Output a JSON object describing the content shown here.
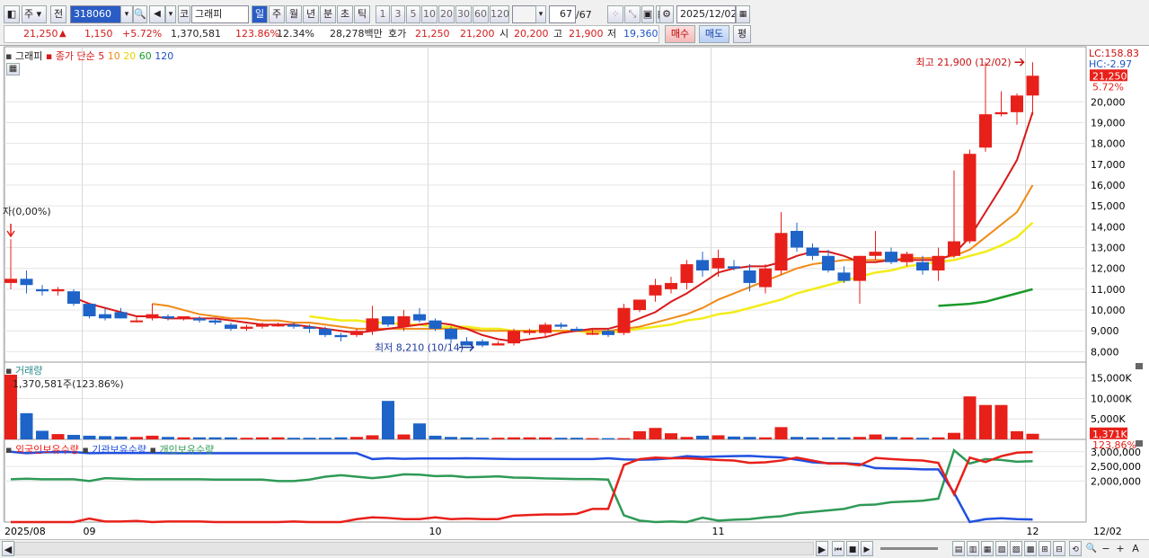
{
  "toolbar": {
    "jong": "주",
    "jeon": "전",
    "code": "318060",
    "name_prefix": "코",
    "stock_name": "그래피",
    "periods": [
      "일",
      "주",
      "월",
      "년",
      "분",
      "초",
      "틱"
    ],
    "active_period": "일",
    "intervals": [
      "1",
      "3",
      "5",
      "10",
      "20",
      "30",
      "60",
      "120"
    ],
    "count": "67",
    "count_total": "/67",
    "date": "2025/12/02"
  },
  "info": {
    "price": "21,250",
    "arrow": "▲",
    "change": "1,150",
    "rate": "+5.72%",
    "volume": "1,370,581",
    "vol_ratio": "123.86%",
    "turnover": "12.34%",
    "amount": "28,278백만",
    "hoga_label": "호가",
    "ask": "21,250",
    "bid": "21,200",
    "open_label": "시",
    "open": "20,200",
    "high_label": "고",
    "high": "21,900",
    "low_label": "저",
    "low": "19,360",
    "buy_btn": "매수",
    "sell_btn": "매도",
    "eval_btn": "평"
  },
  "legend": {
    "name": "그래피",
    "close_label": "종가 단순",
    "ma5": "5",
    "ma10": "10",
    "ma20": "20",
    "ma60": "60",
    "ma120": "120",
    "volume_title": "거래량",
    "volume_value": "1,370,581주(123.86%)",
    "holdings": [
      "외국인보유수량",
      "기관보유수량",
      "개인보유수량"
    ]
  },
  "colors": {
    "up": "#e8201a",
    "down": "#1e63c8",
    "ma5": "#d81a1a",
    "ma10": "#f08a16",
    "ma20": "#f2ec1a",
    "ma60": "#1a9a2a",
    "foreign": "#e8201a",
    "inst": "#2050e0",
    "indiv": "#2e9a56"
  },
  "annotations": {
    "lc": "LC:158.83",
    "hc": "HC:-2.97",
    "cur_price": "21,250",
    "cur_rate": "5.72%",
    "max": "최고 21,900 (12/02)",
    "min": "최저 8,210 (10/14)",
    "first": "자(0,00%)",
    "vol_cur": "1,371K",
    "vol_rate": "123.86%"
  },
  "chart_data": {
    "type": "candlestick",
    "ylim": [
      7500,
      22600
    ],
    "yticks": [
      "8,000",
      "9,000",
      "10,000",
      "11,000",
      "12,000",
      "13,000",
      "14,000",
      "15,000",
      "16,000",
      "17,000",
      "18,000",
      "19,000",
      "20,000"
    ],
    "ytick_values": [
      8000,
      9000,
      10000,
      11000,
      12000,
      13000,
      14000,
      15000,
      16000,
      17000,
      18000,
      19000,
      20000
    ],
    "xlabels": [
      {
        "label": "2025/08",
        "i": 0
      },
      {
        "label": "09",
        "i": 5
      },
      {
        "label": "10",
        "i": 27
      },
      {
        "label": "11",
        "i": 45
      },
      {
        "label": "12",
        "i": 65
      }
    ],
    "xlabel_right": "12/02",
    "candles": [
      [
        11300,
        13400,
        11000,
        11500
      ],
      [
        11500,
        11900,
        10800,
        11200
      ],
      [
        11000,
        11200,
        10700,
        10900
      ],
      [
        10900,
        11100,
        10700,
        11000
      ],
      [
        10900,
        11000,
        10200,
        10300
      ],
      [
        10300,
        10300,
        9600,
        9700
      ],
      [
        9800,
        10100,
        9500,
        9600
      ],
      [
        9900,
        10100,
        9600,
        9600
      ],
      [
        9500,
        9700,
        9400,
        9500
      ],
      [
        9600,
        10300,
        9500,
        9800
      ],
      [
        9700,
        9800,
        9500,
        9600
      ],
      [
        9600,
        9700,
        9500,
        9700
      ],
      [
        9600,
        9700,
        9400,
        9500
      ],
      [
        9500,
        9600,
        9300,
        9400
      ],
      [
        9300,
        9400,
        9000,
        9100
      ],
      [
        9100,
        9300,
        9000,
        9200
      ],
      [
        9200,
        9400,
        9100,
        9300
      ],
      [
        9300,
        9400,
        9200,
        9300
      ],
      [
        9300,
        9400,
        9100,
        9200
      ],
      [
        9200,
        9300,
        8900,
        9100
      ],
      [
        9100,
        9200,
        8700,
        8800
      ],
      [
        8800,
        8900,
        8500,
        8700
      ],
      [
        8800,
        9100,
        8700,
        9000
      ],
      [
        9000,
        10200,
        8800,
        9600
      ],
      [
        9700,
        9700,
        9200,
        9300
      ],
      [
        9200,
        10000,
        9000,
        9700
      ],
      [
        9800,
        10100,
        9400,
        9500
      ],
      [
        9500,
        9600,
        9000,
        9100
      ],
      [
        9100,
        9200,
        8400,
        8600
      ],
      [
        8500,
        8700,
        8300,
        8300
      ],
      [
        8500,
        8600,
        8210,
        8300
      ],
      [
        8300,
        8500,
        8300,
        8400
      ],
      [
        8400,
        9100,
        8300,
        9000
      ],
      [
        8900,
        9100,
        8800,
        9000
      ],
      [
        8900,
        9400,
        8700,
        9300
      ],
      [
        9300,
        9400,
        9100,
        9200
      ],
      [
        9100,
        9200,
        9000,
        9000
      ],
      [
        8900,
        9100,
        8800,
        8900
      ],
      [
        9000,
        9100,
        8700,
        8800
      ],
      [
        8900,
        10300,
        8800,
        10100
      ],
      [
        10000,
        10400,
        9900,
        10500
      ],
      [
        10700,
        11500,
        10400,
        11200
      ],
      [
        11000,
        11600,
        10800,
        11300
      ],
      [
        11300,
        12400,
        11000,
        12200
      ],
      [
        12400,
        12800,
        11600,
        11900
      ],
      [
        12000,
        12900,
        11600,
        12500
      ],
      [
        12100,
        12400,
        11900,
        12000
      ],
      [
        11900,
        12200,
        10900,
        11300
      ],
      [
        11100,
        12200,
        10800,
        12000
      ],
      [
        11900,
        14700,
        11700,
        13700
      ],
      [
        13800,
        14200,
        12800,
        13000
      ],
      [
        13000,
        13200,
        12400,
        12600
      ],
      [
        12600,
        12900,
        11800,
        11900
      ],
      [
        11800,
        12100,
        11300,
        11400
      ],
      [
        11400,
        12600,
        10300,
        12600
      ],
      [
        12600,
        13800,
        12400,
        12800
      ],
      [
        12800,
        13000,
        12200,
        12300
      ],
      [
        12300,
        12800,
        12100,
        12700
      ],
      [
        12300,
        12600,
        11700,
        11900
      ],
      [
        11900,
        13000,
        11400,
        12600
      ],
      [
        12600,
        16700,
        12500,
        13300
      ],
      [
        13300,
        17700,
        13200,
        17500
      ],
      [
        17800,
        21900,
        17600,
        19400
      ],
      [
        19400,
        20500,
        19300,
        19500
      ],
      [
        19500,
        20400,
        18900,
        20300
      ],
      [
        20300,
        21900,
        19360,
        21250
      ]
    ],
    "ma5": [
      null,
      null,
      null,
      null,
      10600,
      10300,
      10100,
      9900,
      9700,
      9700,
      9600,
      9600,
      9600,
      9600,
      9500,
      9400,
      9300,
      9300,
      9300,
      9200,
      9100,
      9000,
      8900,
      9000,
      9100,
      9200,
      9300,
      9400,
      9300,
      9100,
      8800,
      8600,
      8500,
      8600,
      8700,
      8900,
      9000,
      9100,
      9100,
      9300,
      9600,
      9900,
      10400,
      10800,
      11300,
      11800,
      12000,
      12100,
      12100,
      12300,
      12600,
      12800,
      12800,
      12600,
      12300,
      12300,
      12400,
      12400,
      12400,
      12400,
      12700,
      13500,
      14700,
      15900,
      17200,
      19500
    ],
    "ma10": [
      null,
      null,
      null,
      null,
      null,
      null,
      null,
      null,
      null,
      10300,
      10200,
      10000,
      9800,
      9700,
      9600,
      9600,
      9500,
      9500,
      9400,
      9400,
      9300,
      9200,
      9100,
      9100,
      9100,
      9100,
      9100,
      9100,
      9100,
      9100,
      9000,
      9000,
      9000,
      9000,
      9000,
      9000,
      9000,
      9000,
      9000,
      9100,
      9200,
      9400,
      9600,
      9800,
      10100,
      10500,
      10800,
      11100,
      11400,
      11700,
      12000,
      12200,
      12300,
      12400,
      12400,
      12400,
      12400,
      12500,
      12500,
      12500,
      12600,
      12900,
      13500,
      14100,
      14700,
      16000
    ],
    "ma20": [
      null,
      null,
      null,
      null,
      null,
      null,
      null,
      null,
      null,
      null,
      null,
      null,
      null,
      null,
      null,
      null,
      null,
      null,
      null,
      9700,
      9600,
      9500,
      9500,
      9400,
      9400,
      9300,
      9300,
      9200,
      9200,
      9200,
      9100,
      9100,
      9000,
      9000,
      9000,
      9000,
      9000,
      8900,
      8900,
      9000,
      9100,
      9200,
      9300,
      9500,
      9600,
      9800,
      9900,
      10100,
      10300,
      10500,
      10800,
      11000,
      11200,
      11400,
      11600,
      11800,
      11900,
      12100,
      12200,
      12300,
      12400,
      12600,
      12800,
      13100,
      13500,
      14200
    ],
    "ma60": [
      null,
      null,
      null,
      null,
      null,
      null,
      null,
      null,
      null,
      null,
      null,
      null,
      null,
      null,
      null,
      null,
      null,
      null,
      null,
      null,
      null,
      null,
      null,
      null,
      null,
      null,
      null,
      null,
      null,
      null,
      null,
      null,
      null,
      null,
      null,
      null,
      null,
      null,
      null,
      null,
      null,
      null,
      null,
      null,
      null,
      null,
      null,
      null,
      null,
      null,
      null,
      null,
      null,
      null,
      null,
      null,
      null,
      null,
      null,
      10200,
      10250,
      10300,
      10400,
      10600,
      10800,
      11000
    ],
    "volume_ylim": [
      0,
      18000
    ],
    "volume_ticks": [
      "5,000K",
      "10,000K",
      "15,000K"
    ],
    "volume_tick_values": [
      5000,
      10000,
      15000
    ],
    "volumes": [
      15800,
      6400,
      2100,
      1300,
      1100,
      900,
      800,
      700,
      600,
      900,
      600,
      500,
      500,
      500,
      500,
      400,
      500,
      500,
      400,
      400,
      400,
      500,
      600,
      1000,
      9400,
      1200,
      3900,
      900,
      600,
      500,
      400,
      400,
      500,
      500,
      500,
      400,
      400,
      300,
      300,
      300,
      2000,
      2800,
      1500,
      600,
      900,
      1000,
      700,
      600,
      500,
      3000,
      600,
      500,
      500,
      500,
      600,
      1200,
      600,
      500,
      400,
      500,
      1600,
      10500,
      8400,
      8400,
      2000,
      1371
    ],
    "holdings_ylim": [
      600000,
      3300000
    ],
    "holdings_ticks": [
      "2,000,000",
      "2,500,000",
      "3,000,000"
    ],
    "holdings_tick_values": [
      2000000,
      2500000,
      3000000
    ],
    "foreign": [
      600000,
      600000,
      600000,
      600000,
      600000,
      720000,
      620000,
      620000,
      640000,
      600000,
      620000,
      620000,
      620000,
      600000,
      600000,
      600000,
      600000,
      600000,
      620000,
      600000,
      600000,
      600000,
      700000,
      760000,
      740000,
      700000,
      700000,
      760000,
      700000,
      720000,
      700000,
      700000,
      820000,
      840000,
      860000,
      860000,
      880000,
      1050000,
      1050000,
      2550000,
      2750000,
      2800000,
      2780000,
      2780000,
      2750000,
      2720000,
      2700000,
      2620000,
      2640000,
      2700000,
      2800000,
      2700000,
      2600000,
      2600000,
      2540000,
      2790000,
      2750000,
      2720000,
      2700000,
      2620000,
      1550000,
      2800000,
      2650000,
      2850000,
      2970000,
      2990000
    ],
    "inst": [
      3000000,
      2950000,
      2980000,
      2990000,
      2990000,
      2950000,
      2960000,
      2960000,
      2960000,
      2960000,
      2950000,
      2950000,
      2950000,
      2950000,
      2950000,
      2950000,
      2950000,
      2950000,
      2950000,
      2950000,
      2950000,
      2950000,
      2950000,
      2750000,
      2780000,
      2760000,
      2770000,
      2770000,
      2770000,
      2780000,
      2770000,
      2760000,
      2750000,
      2750000,
      2750000,
      2750000,
      2750000,
      2750000,
      2780000,
      2740000,
      2730000,
      2740000,
      2780000,
      2850000,
      2820000,
      2840000,
      2850000,
      2860000,
      2830000,
      2810000,
      2730000,
      2640000,
      2610000,
      2610000,
      2580000,
      2440000,
      2430000,
      2420000,
      2400000,
      2400000,
      1600000,
      600000,
      700000,
      730000,
      700000,
      690000
    ],
    "indiv": [
      2060000,
      2080000,
      2060000,
      2060000,
      2060000,
      2000000,
      2100000,
      2080000,
      2060000,
      2060000,
      2060000,
      2060000,
      2060000,
      2050000,
      2050000,
      2050000,
      2050000,
      2000000,
      2000000,
      2050000,
      2150000,
      2200000,
      2150000,
      2100000,
      2150000,
      2230000,
      2220000,
      2170000,
      2180000,
      2130000,
      2140000,
      2160000,
      2120000,
      2110000,
      2090000,
      2080000,
      2070000,
      2070000,
      2050000,
      830000,
      650000,
      600000,
      620000,
      600000,
      750000,
      650000,
      680000,
      700000,
      760000,
      800000,
      900000,
      950000,
      1000000,
      1050000,
      1180000,
      1200000,
      1280000,
      1300000,
      1330000,
      1400000,
      3050000,
      2600000,
      2750000,
      2720000,
      2660000,
      2680000
    ]
  }
}
